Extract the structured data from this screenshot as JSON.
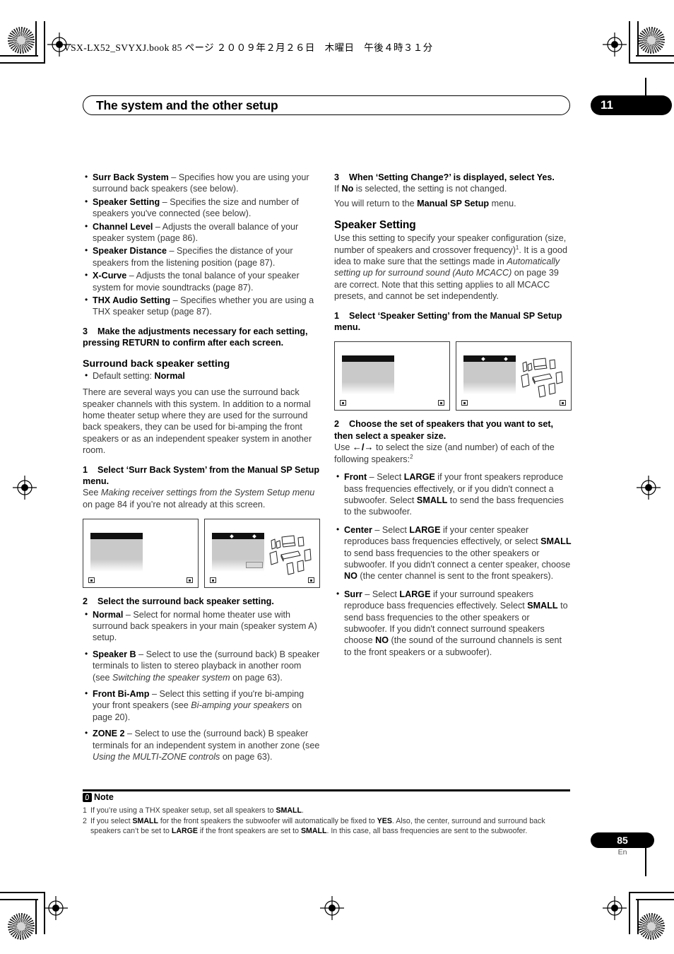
{
  "printer_line": "VSX-LX52_SVYXJ.book   85 ページ   ２００９年２月２６日　木曜日　午後４時３１分",
  "chapter": {
    "title": "The system and the other setup",
    "number": "11"
  },
  "left_column": {
    "settings_bullets": [
      {
        "term": "Surr Back System",
        "desc": " – Specifies how you are using your surround back speakers (see below)."
      },
      {
        "term": "Speaker Setting",
        "desc": " – Specifies the size and number of speakers you've connected (see below)."
      },
      {
        "term": "Channel Level",
        "desc": " – Adjusts the overall balance of your speaker system (page 86)."
      },
      {
        "term": "Speaker Distance",
        "desc": " – Specifies the distance of your speakers from the listening position (page 87)."
      },
      {
        "term": "X-Curve",
        "desc": " – Adjusts the tonal balance of your speaker system for movie soundtracks (page 87)."
      },
      {
        "term": "THX Audio Setting",
        "desc": " – Specifies whether you are using a THX speaker setup (page 87)."
      }
    ],
    "step3": {
      "num": "3",
      "text": "Make the adjustments necessary for each setting, pressing RETURN to confirm after each screen."
    },
    "heading": "Surround back speaker setting",
    "default_bullet_label": "Default setting: ",
    "default_bullet_value": "Normal",
    "intro_paragraph": "There are several ways you can use the surround back speaker channels with this system. In addition to a normal home theater setup where they are used for the surround back speakers, they can be used for bi-amping the front speakers or as an independent speaker system in another room.",
    "step1": {
      "num": "1",
      "text": "Select ‘Surr Back System’ from the Manual SP Setup menu."
    },
    "step1_body_pre": "See ",
    "step1_body_italic": "Making receiver settings from the System Setup menu",
    "step1_body_post": " on page 84 if you’re not already at this screen.",
    "step2": {
      "num": "2",
      "text": "Select the surround back speaker setting."
    },
    "option_bullets": [
      {
        "term": "Normal",
        "desc": " – Select for normal home theater use with surround back speakers in your main (speaker system A) setup."
      },
      {
        "term": "Speaker B",
        "desc": " – Select to use the (surround back) B speaker terminals to listen to stereo playback in another room (see ",
        "italic": "Switching the speaker system",
        "desc2": " on page 63)."
      },
      {
        "term": "Front Bi-Amp",
        "desc": " – Select this setting if you're bi-amping your front speakers (see ",
        "italic": "Bi-amping your speakers",
        "desc2": " on page 20)."
      },
      {
        "term": "ZONE 2",
        "desc": " – Select to use the (surround back) B speaker terminals for an independent system in another zone (see ",
        "italic": "Using the MULTI-ZONE controls",
        "desc2": " on page 63)."
      }
    ]
  },
  "right_column": {
    "step3": {
      "num": "3",
      "text": "When ‘Setting Change?’ is displayed, select Yes."
    },
    "step3_line1_pre": "If ",
    "step3_line1_bold": "No",
    "step3_line1_post": " is selected, the setting is not changed.",
    "step3_line2_pre": "You will return to the ",
    "step3_line2_bold": "Manual SP Setup",
    "step3_line2_post": " menu.",
    "heading": "Speaker Setting",
    "intro_a": "Use this setting to specify your speaker configuration (size, number of speakers and crossover frequency)",
    "intro_sup": "1",
    "intro_b": ". It is a good idea to make sure that the settings made in ",
    "intro_italic": "Automatically setting up for surround sound (Auto MCACC)",
    "intro_c": " on page 39 are correct. Note that this setting applies to all MCACC presets, and cannot be set independently.",
    "step1": {
      "num": "1",
      "text": "Select ‘Speaker Setting’ from the Manual SP Setup menu."
    },
    "step2": {
      "num": "2",
      "text": "Choose the set of speakers that you want to set, then select a speaker size."
    },
    "step2_body_pre": "Use ",
    "step2_arrows": "←/→",
    "step2_body_post": " to select the size (and number) of each of the following speakers:",
    "step2_sup": "2",
    "speaker_bullets": [
      {
        "term": "Front",
        "desc": " – Select LARGE if your front speakers reproduce bass frequencies effectively, or if you didn't connect a subwoofer. Select SMALL to send the bass frequencies to the subwoofer."
      },
      {
        "term": "Center",
        "desc": " – Select LARGE if your center speaker reproduces bass frequencies effectively, or select SMALL to send bass frequencies to the other speakers or subwoofer. If you didn't connect a center speaker, choose NO (the center channel is sent to the front speakers)."
      },
      {
        "term": "Surr",
        "desc": " – Select LARGE if your surround speakers reproduce bass frequencies effectively. Select SMALL to send bass frequencies to the other speakers or subwoofer. If you didn't connect surround speakers choose NO (the sound of the surround channels is sent to the front speakers or a subwoofer)."
      }
    ]
  },
  "note": {
    "label": "Note",
    "items": [
      {
        "num": "1",
        "text": "If you’re using a THX speaker setup, set all speakers to SMALL."
      },
      {
        "num": "2",
        "text": "If you select SMALL for the front speakers the subwoofer will automatically be fixed to YES. Also, the center, surround and surround back speakers can’t be set to LARGE if the front speakers are set to SMALL. In this case, all bass frequencies are sent to the subwoofer."
      }
    ]
  },
  "footer": {
    "page": "85",
    "lang": "En"
  },
  "icons": {
    "note_icon": "note-pencil-icon",
    "osd_badge": "osd-corner-badge-icon",
    "registration": "registration-crosshair-icon"
  }
}
